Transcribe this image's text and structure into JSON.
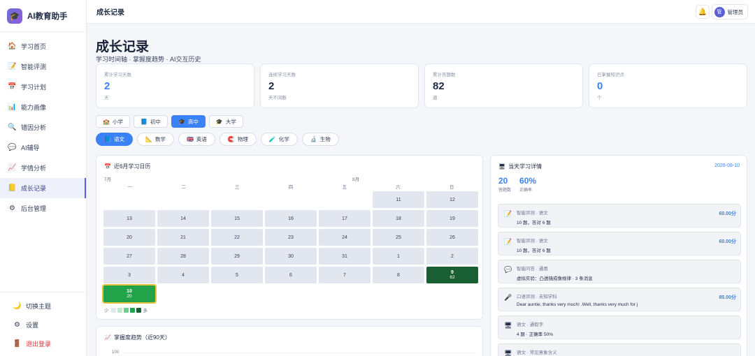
{
  "brand": {
    "title": "AI教育助手"
  },
  "sidebar": {
    "items": [
      {
        "label": "学习首页",
        "icon": "home-icon"
      },
      {
        "label": "智能评测",
        "icon": "memo-icon"
      },
      {
        "label": "学习计划",
        "icon": "calendar-icon"
      },
      {
        "label": "能力画像",
        "icon": "bar-chart-icon"
      },
      {
        "label": "错因分析",
        "icon": "magnifier-icon"
      },
      {
        "label": "AI辅导",
        "icon": "chat-icon"
      },
      {
        "label": "学情分析",
        "icon": "trend-icon"
      },
      {
        "label": "成长记录",
        "icon": "notebook-icon",
        "active": true
      },
      {
        "label": "后台管理",
        "icon": "gear-icon"
      }
    ],
    "bottom": [
      {
        "label": "切换主题",
        "icon": "moon-icon"
      },
      {
        "label": "设置",
        "icon": "settings-icon"
      },
      {
        "label": "退出登录",
        "icon": "door-icon"
      }
    ]
  },
  "topbar": {
    "title": "成长记录",
    "username": "管理员"
  },
  "page": {
    "title": "成长记录",
    "subtitle": "学习时间轴 · 掌握度趋势 · AI交互历史"
  },
  "stats": [
    {
      "label": "累计学习天数",
      "value": "2",
      "unit": "天",
      "highlight": true
    },
    {
      "label": "连续学习天数",
      "value": "2",
      "unit": "天不间断",
      "highlight": false
    },
    {
      "label": "累计答题数",
      "value": "82",
      "unit": "道",
      "highlight": false
    },
    {
      "label": "已掌握知识点",
      "value": "0",
      "unit": "个",
      "highlight": true
    }
  ],
  "levels": [
    {
      "label": "小学",
      "icon": "school-icon"
    },
    {
      "label": "初中",
      "icon": "book-icon"
    },
    {
      "label": "高中",
      "icon": "graduation-cap-icon",
      "active": true
    },
    {
      "label": "大学",
      "icon": "mortarboard-icon"
    }
  ],
  "subjects": [
    {
      "label": "语文",
      "icon": "book-icon",
      "active": true
    },
    {
      "label": "数学",
      "icon": "ruler-icon"
    },
    {
      "label": "英语",
      "icon": "flag-icon"
    },
    {
      "label": "物理",
      "icon": "magnet-icon"
    },
    {
      "label": "化学",
      "icon": "flask-icon"
    },
    {
      "label": "生物",
      "icon": "microscope-icon"
    }
  ],
  "calendar": {
    "title": "近6月学习日历",
    "month_left": "7月",
    "month_right": "8月",
    "weekdays": [
      "一",
      "二",
      "三",
      "四",
      "五",
      "六",
      "日"
    ],
    "rows": [
      [
        null,
        null,
        null,
        null,
        null,
        {
          "d": "11"
        },
        {
          "d": "12"
        }
      ],
      [
        {
          "d": "13"
        },
        {
          "d": "14"
        },
        {
          "d": "15"
        },
        {
          "d": "16"
        },
        {
          "d": "17"
        },
        {
          "d": "18"
        },
        {
          "d": "19"
        }
      ],
      [
        {
          "d": "20"
        },
        {
          "d": "21"
        },
        {
          "d": "22"
        },
        {
          "d": "23"
        },
        {
          "d": "24"
        },
        {
          "d": "25"
        },
        {
          "d": "26"
        }
      ],
      [
        {
          "d": "27"
        },
        {
          "d": "28"
        },
        {
          "d": "29"
        },
        {
          "d": "30"
        },
        {
          "d": "31"
        },
        {
          "d": "1"
        },
        {
          "d": "2"
        }
      ],
      [
        {
          "d": "3"
        },
        {
          "d": "4"
        },
        {
          "d": "5"
        },
        {
          "d": "6"
        },
        {
          "d": "7"
        },
        {
          "d": "8"
        },
        {
          "d": "9",
          "n": "62",
          "level": "dark"
        }
      ],
      [
        {
          "d": "10",
          "n": "20",
          "level": "today"
        },
        null,
        null,
        null,
        null,
        null,
        null
      ]
    ],
    "legend_less": "少",
    "legend_more": "多",
    "legend_colors": [
      "#e2e6ee",
      "#bfe8cb",
      "#6fd08e",
      "#22a34a",
      "#1a5e34"
    ]
  },
  "mastery": {
    "title": "掌握度趋势（近90天）",
    "y_top": "100"
  },
  "detail": {
    "title": "当天学习详情",
    "date": "2026-08-10",
    "count": "20",
    "count_label": "答题数",
    "accuracy": "60%",
    "accuracy_label": "正确率",
    "records": [
      {
        "icon": "memo-icon",
        "title": "智能评测 · 语文",
        "desc": "10 题，答对 6 题",
        "score": "60.00分"
      },
      {
        "icon": "memo-icon",
        "title": "智能评测 · 语文",
        "desc": "10 题，答对 6 题",
        "score": "60.00分"
      },
      {
        "icon": "chat-icon",
        "title": "智能问答 · 通用",
        "desc": "虚拟实验：凸透镜成像规律 · 3 条消息",
        "score": ""
      },
      {
        "icon": "microphone-icon",
        "title": "口语评测 · 未知学科",
        "desc": "Dear auntie, thanks very much! .Well, thanks very much for j",
        "score": "85.00分"
      },
      {
        "icon": "monitor-icon",
        "title": "语文 · 通假字",
        "desc": "4 题 · 正确率 50%",
        "score": ""
      },
      {
        "icon": "monitor-icon",
        "title": "语文 · 常见意象含义",
        "desc": "",
        "score": ""
      }
    ]
  },
  "colors": {
    "accent": "#3b82f6",
    "brand": "#5b5fd6",
    "cal_dark": "#1a5e34",
    "cal_today": "#22a34a"
  }
}
